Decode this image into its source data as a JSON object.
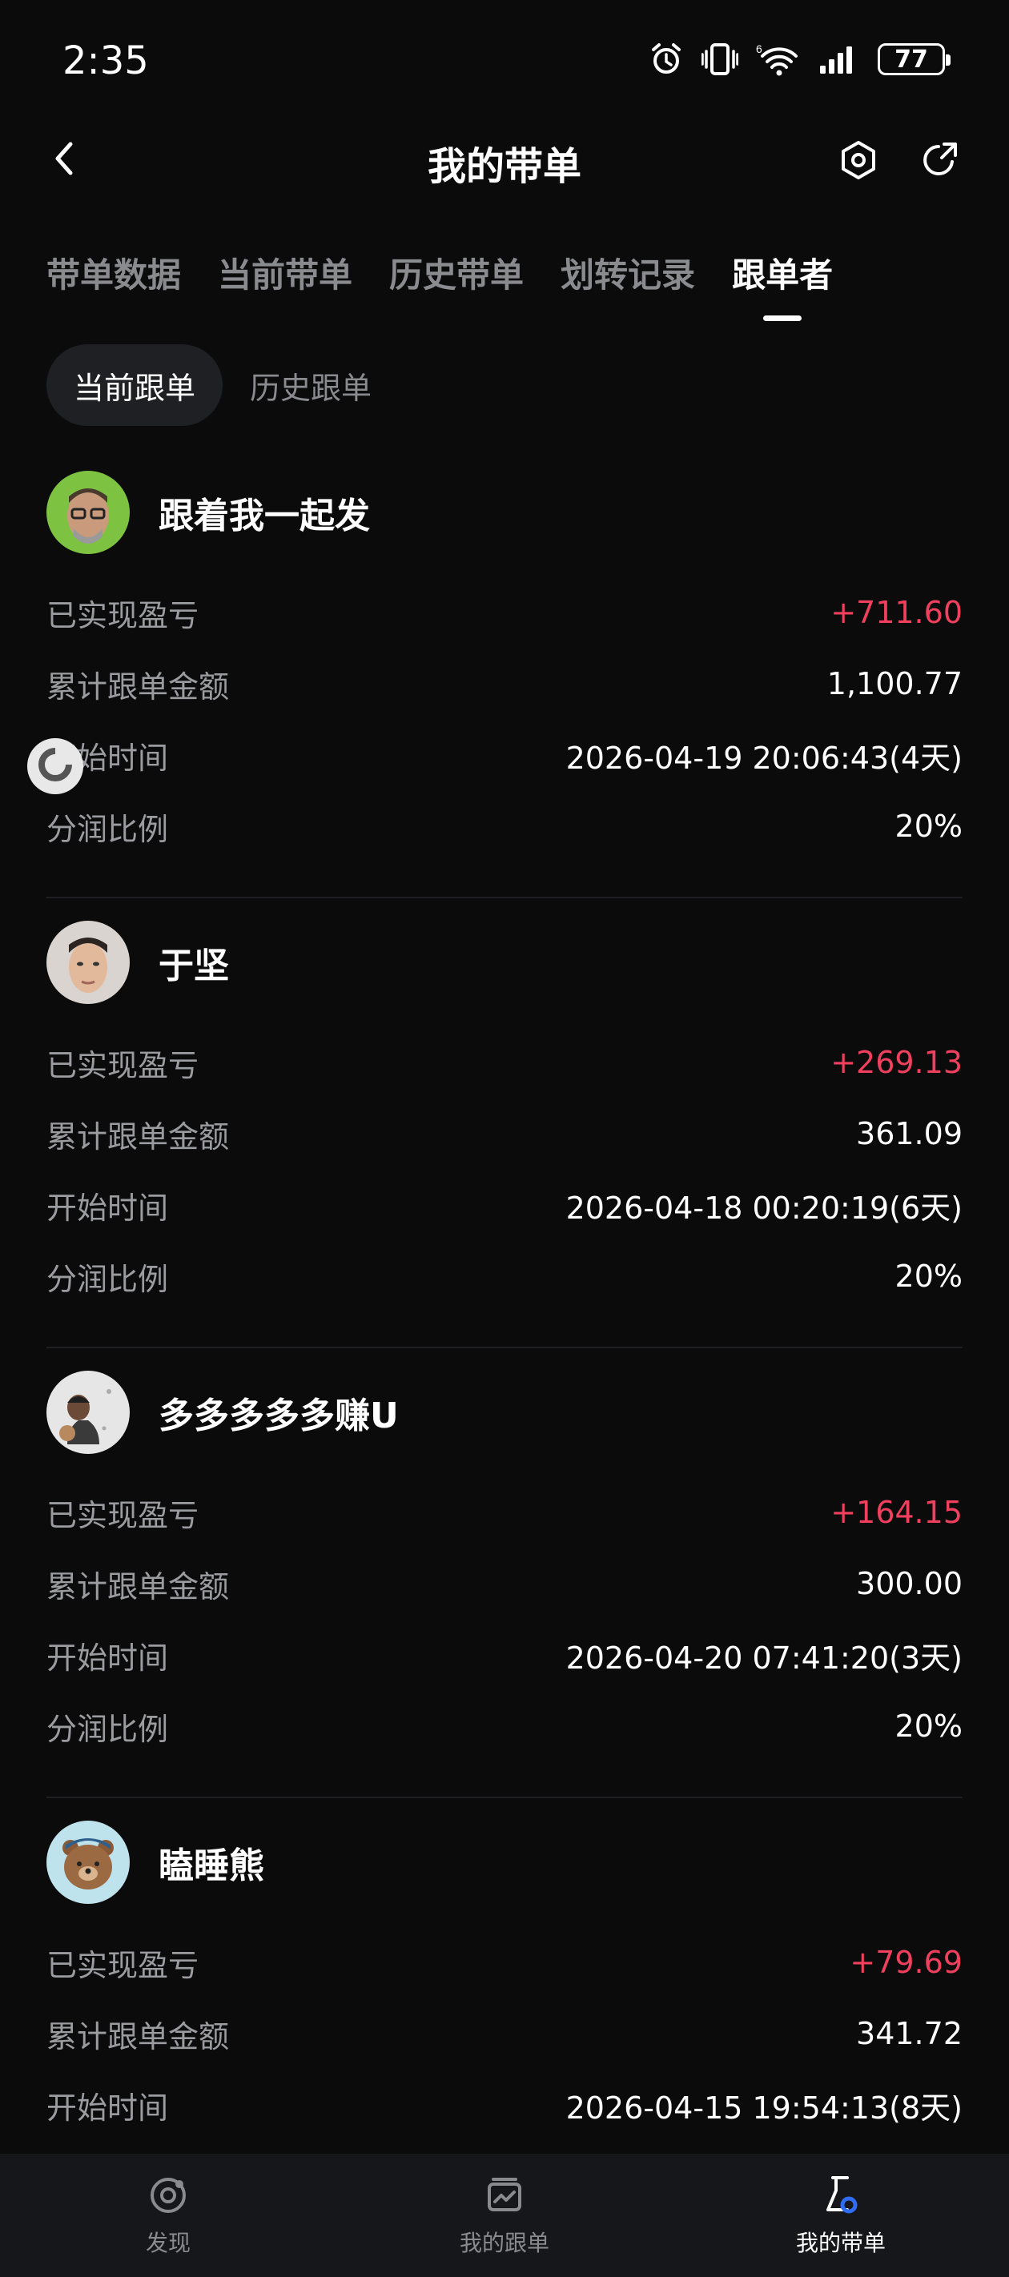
{
  "status_bar": {
    "time": "2:35",
    "battery": "77",
    "icons": [
      "alarm-icon",
      "vibrate-icon",
      "wifi-icon",
      "signal-icon",
      "battery-icon"
    ]
  },
  "header": {
    "title": "我的带单"
  },
  "tabs": [
    {
      "label": "带单数据",
      "active": false
    },
    {
      "label": "当前带单",
      "active": false
    },
    {
      "label": "历史带单",
      "active": false
    },
    {
      "label": "划转记录",
      "active": false
    },
    {
      "label": "跟单者",
      "active": true
    }
  ],
  "subtabs": [
    {
      "label": "当前跟单",
      "active": true
    },
    {
      "label": "历史跟单",
      "active": false
    }
  ],
  "labels": {
    "pnl": "已实现盈亏",
    "amount": "累计跟单金额",
    "start": "开始时间",
    "share": "分润比例"
  },
  "followers": [
    {
      "name": "跟着我一起发",
      "pnl": "+711.60",
      "amount": "1,100.77",
      "start": "2026-04-19 20:06:43(4天)",
      "share": "20%"
    },
    {
      "name": "于坚",
      "pnl": "+269.13",
      "amount": "361.09",
      "start": "2026-04-18 00:20:19(6天)",
      "share": "20%"
    },
    {
      "name": "多多多多多赚U",
      "pnl": "+164.15",
      "amount": "300.00",
      "start": "2026-04-20 07:41:20(3天)",
      "share": "20%"
    },
    {
      "name": "瞌睡熊",
      "pnl": "+79.69",
      "amount": "341.72",
      "start": "2026-04-15 19:54:13(8天)"
    }
  ],
  "bottom_nav": [
    {
      "label": "发现",
      "icon": "discover-icon",
      "active": false
    },
    {
      "label": "我的跟单",
      "icon": "copy-trade-icon",
      "active": false
    },
    {
      "label": "我的带单",
      "icon": "lead-trade-icon",
      "active": true
    }
  ],
  "colors": {
    "background": "#0b0b0c",
    "profit": "#f0405e",
    "label": "#9b9ca0",
    "bottom_nav_bg": "#16171a"
  }
}
